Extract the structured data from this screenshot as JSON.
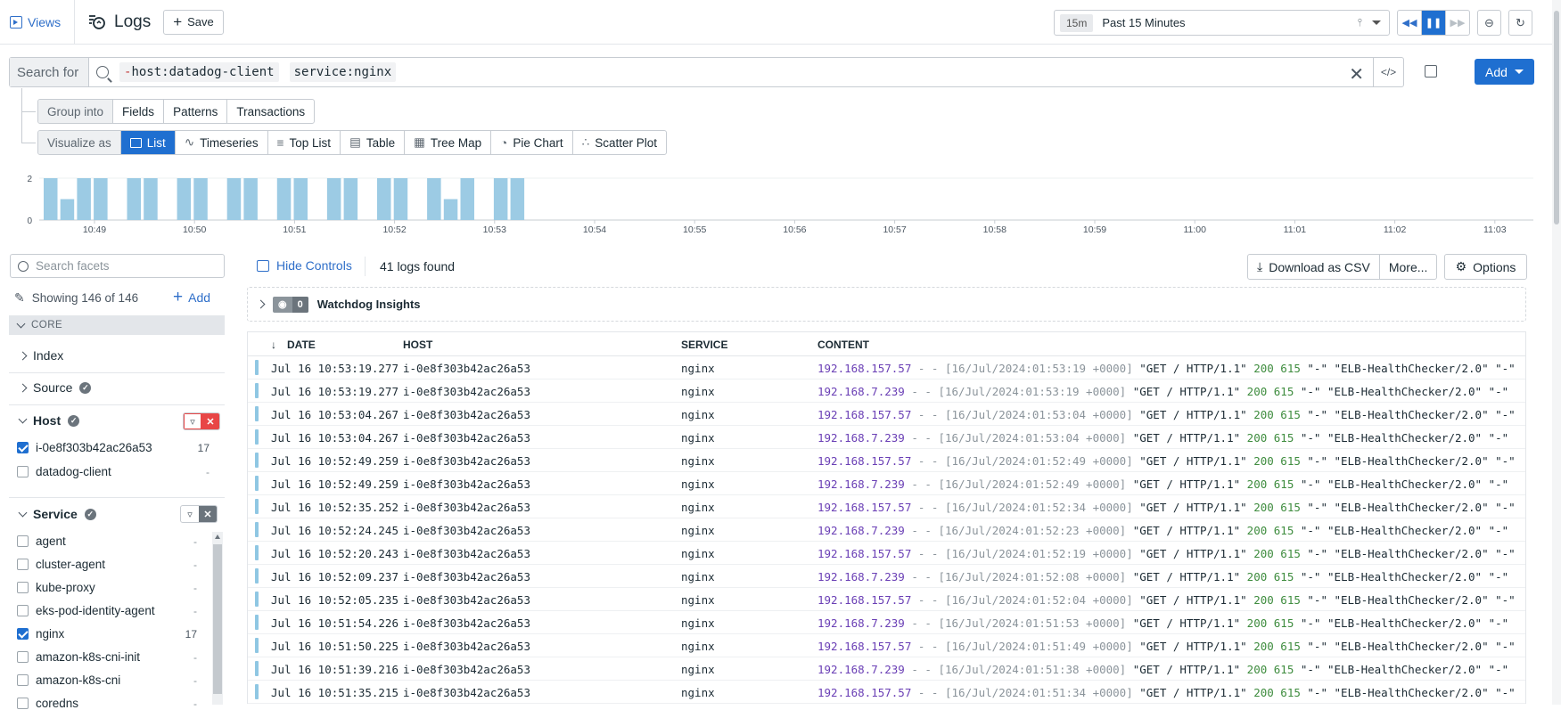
{
  "topbar": {
    "views_label": "Views",
    "title": "Logs",
    "save_label": "Save",
    "time_badge": "15m",
    "time_label": "Past 15 Minutes"
  },
  "search": {
    "label": "Search for",
    "chips": [
      "-host:datadog-client",
      "service:nginx"
    ],
    "add_label": "Add"
  },
  "group": {
    "label": "Group into",
    "options": [
      "Fields",
      "Patterns",
      "Transactions"
    ]
  },
  "visualize": {
    "label": "Visualize as",
    "options": [
      "List",
      "Timeseries",
      "Top List",
      "Table",
      "Tree Map",
      "Pie Chart",
      "Scatter Plot"
    ],
    "selected": "List"
  },
  "chart_data": {
    "type": "bar",
    "y_ticks": [
      "2",
      "0"
    ],
    "ylim": [
      0,
      2
    ],
    "x_ticks": [
      "10:49",
      "10:50",
      "10:51",
      "10:52",
      "10:53",
      "10:54",
      "10:55",
      "10:56",
      "10:57",
      "10:58",
      "10:59",
      "11:00",
      "11:01",
      "11:02",
      "11:03"
    ],
    "values": [
      2,
      1,
      2,
      2,
      0,
      2,
      2,
      0,
      2,
      2,
      0,
      2,
      2,
      0,
      2,
      2,
      0,
      2,
      2,
      0,
      2,
      2,
      0,
      2,
      1,
      2,
      0,
      2,
      2
    ],
    "color": "#9ccbe4"
  },
  "facets": {
    "search_placeholder": "Search facets",
    "showing": "Showing 146 of 146",
    "add_label": "Add",
    "core_label": "CORE",
    "index_label": "Index",
    "source_label": "Source",
    "host": {
      "label": "Host",
      "items": [
        {
          "name": "i-0e8f303b42ac26a53",
          "count": "17",
          "checked": true
        },
        {
          "name": "datadog-client",
          "count": "-",
          "checked": false
        }
      ]
    },
    "service": {
      "label": "Service",
      "items": [
        {
          "name": "agent",
          "count": "-",
          "checked": false
        },
        {
          "name": "cluster-agent",
          "count": "-",
          "checked": false
        },
        {
          "name": "kube-proxy",
          "count": "-",
          "checked": false
        },
        {
          "name": "eks-pod-identity-agent",
          "count": "-",
          "checked": false
        },
        {
          "name": "nginx",
          "count": "17",
          "checked": true
        },
        {
          "name": "amazon-k8s-cni-init",
          "count": "-",
          "checked": false
        },
        {
          "name": "amazon-k8s-cni",
          "count": "-",
          "checked": false
        },
        {
          "name": "coredns",
          "count": "-",
          "checked": false
        }
      ]
    }
  },
  "controls": {
    "hide_controls": "Hide Controls",
    "logs_found": "41 logs found",
    "download_csv": "Download as CSV",
    "more": "More...",
    "options": "Options",
    "watchdog_count": "0",
    "watchdog_label": "Watchdog Insights"
  },
  "table": {
    "headers": {
      "date": "DATE",
      "host": "HOST",
      "service": "SERVICE",
      "content": "CONTENT"
    },
    "rows": [
      {
        "date": "Jul 16 10:53:19.277",
        "host": "i-0e8f303b42ac26a53",
        "service": "nginx",
        "ip": "192.168.157.57",
        "dash": " - - ",
        "ts": "[16/Jul/2024:01:53:19 +0000]",
        "req": " \"GET / HTTP/1.1\" ",
        "status": "200 615",
        "tail": " \"-\" \"ELB-HealthChecker/2.0\" \"-\""
      },
      {
        "date": "Jul 16 10:53:19.277",
        "host": "i-0e8f303b42ac26a53",
        "service": "nginx",
        "ip": "192.168.7.239",
        "dash": " - - ",
        "ts": "[16/Jul/2024:01:53:19 +0000]",
        "req": " \"GET / HTTP/1.1\" ",
        "status": "200 615",
        "tail": " \"-\" \"ELB-HealthChecker/2.0\" \"-\""
      },
      {
        "date": "Jul 16 10:53:04.267",
        "host": "i-0e8f303b42ac26a53",
        "service": "nginx",
        "ip": "192.168.157.57",
        "dash": " - - ",
        "ts": "[16/Jul/2024:01:53:04 +0000]",
        "req": " \"GET / HTTP/1.1\" ",
        "status": "200 615",
        "tail": " \"-\" \"ELB-HealthChecker/2.0\" \"-\""
      },
      {
        "date": "Jul 16 10:53:04.267",
        "host": "i-0e8f303b42ac26a53",
        "service": "nginx",
        "ip": "192.168.7.239",
        "dash": " - - ",
        "ts": "[16/Jul/2024:01:53:04 +0000]",
        "req": " \"GET / HTTP/1.1\" ",
        "status": "200 615",
        "tail": " \"-\" \"ELB-HealthChecker/2.0\" \"-\""
      },
      {
        "date": "Jul 16 10:52:49.259",
        "host": "i-0e8f303b42ac26a53",
        "service": "nginx",
        "ip": "192.168.157.57",
        "dash": " - - ",
        "ts": "[16/Jul/2024:01:52:49 +0000]",
        "req": " \"GET / HTTP/1.1\" ",
        "status": "200 615",
        "tail": " \"-\" \"ELB-HealthChecker/2.0\" \"-\""
      },
      {
        "date": "Jul 16 10:52:49.259",
        "host": "i-0e8f303b42ac26a53",
        "service": "nginx",
        "ip": "192.168.7.239",
        "dash": " - - ",
        "ts": "[16/Jul/2024:01:52:49 +0000]",
        "req": " \"GET / HTTP/1.1\" ",
        "status": "200 615",
        "tail": " \"-\" \"ELB-HealthChecker/2.0\" \"-\""
      },
      {
        "date": "Jul 16 10:52:35.252",
        "host": "i-0e8f303b42ac26a53",
        "service": "nginx",
        "ip": "192.168.157.57",
        "dash": " - - ",
        "ts": "[16/Jul/2024:01:52:34 +0000]",
        "req": " \"GET / HTTP/1.1\" ",
        "status": "200 615",
        "tail": " \"-\" \"ELB-HealthChecker/2.0\" \"-\""
      },
      {
        "date": "Jul 16 10:52:24.245",
        "host": "i-0e8f303b42ac26a53",
        "service": "nginx",
        "ip": "192.168.7.239",
        "dash": " - - ",
        "ts": "[16/Jul/2024:01:52:23 +0000]",
        "req": " \"GET / HTTP/1.1\" ",
        "status": "200 615",
        "tail": " \"-\" \"ELB-HealthChecker/2.0\" \"-\""
      },
      {
        "date": "Jul 16 10:52:20.243",
        "host": "i-0e8f303b42ac26a53",
        "service": "nginx",
        "ip": "192.168.157.57",
        "dash": " - - ",
        "ts": "[16/Jul/2024:01:52:19 +0000]",
        "req": " \"GET / HTTP/1.1\" ",
        "status": "200 615",
        "tail": " \"-\" \"ELB-HealthChecker/2.0\" \"-\""
      },
      {
        "date": "Jul 16 10:52:09.237",
        "host": "i-0e8f303b42ac26a53",
        "service": "nginx",
        "ip": "192.168.7.239",
        "dash": " - - ",
        "ts": "[16/Jul/2024:01:52:08 +0000]",
        "req": " \"GET / HTTP/1.1\" ",
        "status": "200 615",
        "tail": " \"-\" \"ELB-HealthChecker/2.0\" \"-\""
      },
      {
        "date": "Jul 16 10:52:05.235",
        "host": "i-0e8f303b42ac26a53",
        "service": "nginx",
        "ip": "192.168.157.57",
        "dash": " - - ",
        "ts": "[16/Jul/2024:01:52:04 +0000]",
        "req": " \"GET / HTTP/1.1\" ",
        "status": "200 615",
        "tail": " \"-\" \"ELB-HealthChecker/2.0\" \"-\""
      },
      {
        "date": "Jul 16 10:51:54.226",
        "host": "i-0e8f303b42ac26a53",
        "service": "nginx",
        "ip": "192.168.7.239",
        "dash": " - - ",
        "ts": "[16/Jul/2024:01:51:53 +0000]",
        "req": " \"GET / HTTP/1.1\" ",
        "status": "200 615",
        "tail": " \"-\" \"ELB-HealthChecker/2.0\" \"-\""
      },
      {
        "date": "Jul 16 10:51:50.225",
        "host": "i-0e8f303b42ac26a53",
        "service": "nginx",
        "ip": "192.168.157.57",
        "dash": " - - ",
        "ts": "[16/Jul/2024:01:51:49 +0000]",
        "req": " \"GET / HTTP/1.1\" ",
        "status": "200 615",
        "tail": " \"-\" \"ELB-HealthChecker/2.0\" \"-\""
      },
      {
        "date": "Jul 16 10:51:39.216",
        "host": "i-0e8f303b42ac26a53",
        "service": "nginx",
        "ip": "192.168.7.239",
        "dash": " - - ",
        "ts": "[16/Jul/2024:01:51:38 +0000]",
        "req": " \"GET / HTTP/1.1\" ",
        "status": "200 615",
        "tail": " \"-\" \"ELB-HealthChecker/2.0\" \"-\""
      },
      {
        "date": "Jul 16 10:51:35.215",
        "host": "i-0e8f303b42ac26a53",
        "service": "nginx",
        "ip": "192.168.157.57",
        "dash": " - - ",
        "ts": "[16/Jul/2024:01:51:34 +0000]",
        "req": " \"GET / HTTP/1.1\" ",
        "status": "200 615",
        "tail": " \"-\" \"ELB-HealthChecker/2.0\" \"-\""
      }
    ]
  },
  "colors": {
    "accent": "#1f6fd0",
    "bar": "#9ccbe4",
    "ip": "#6a3fb5",
    "status": "#3e8c3e",
    "danger": "#e84646"
  }
}
